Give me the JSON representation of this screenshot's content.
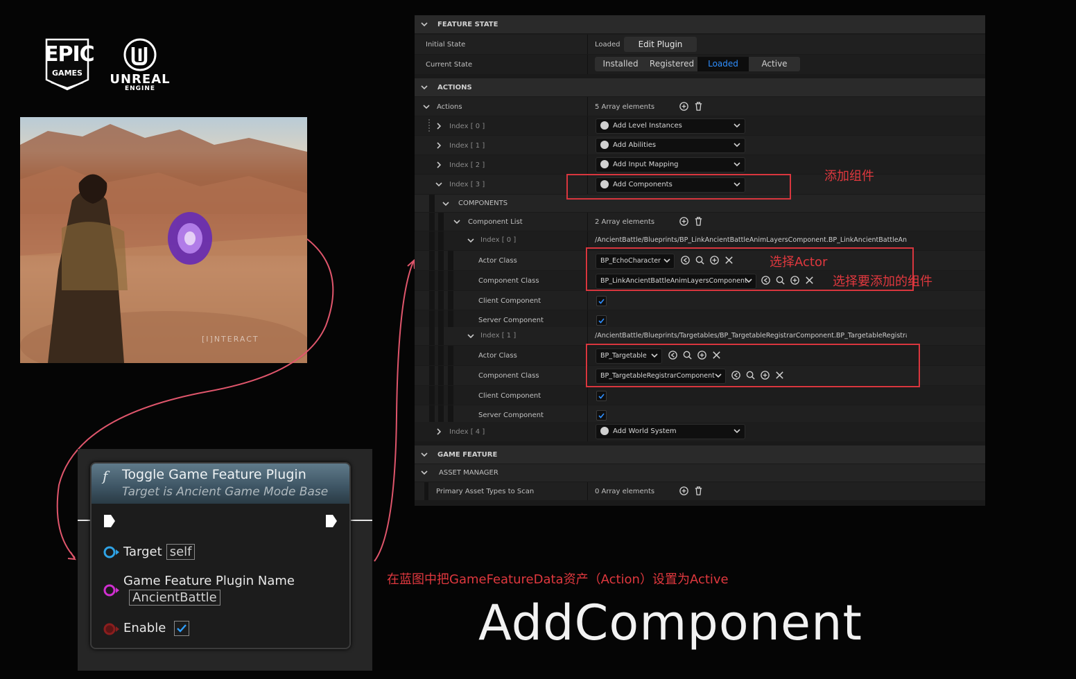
{
  "logos": {
    "epic_line1": "EPIC",
    "epic_line2": "GAMES",
    "unreal_line1": "UNREAL",
    "unreal_line2": "ENGINE"
  },
  "scene": {
    "watermark": "[I]NTERACT"
  },
  "node": {
    "title": "Toggle Game Feature Plugin",
    "subtitle": "Target is Ancient Game Mode Base",
    "target_label": "Target",
    "target_value": "self",
    "plugin_label": "Game Feature Plugin Name",
    "plugin_value": "AncientBattle",
    "enable_label": "Enable",
    "enable_checked": true
  },
  "panel": {
    "feature_state": {
      "header": "FEATURE STATE",
      "initial_state_label": "Initial State",
      "initial_state_value": "Loaded",
      "edit_plugin_button": "Edit Plugin",
      "current_state_label": "Current State",
      "states": [
        "Installed",
        "Registered",
        "Loaded",
        "Active"
      ],
      "selected_state": "Loaded"
    },
    "actions": {
      "header": "ACTIONS",
      "actions_label": "Actions",
      "actions_count": "5 Array elements",
      "items": [
        {
          "index": "Index [ 0 ]",
          "value": "Add Level Instances"
        },
        {
          "index": "Index [ 1 ]",
          "value": "Add Abilities"
        },
        {
          "index": "Index [ 2 ]",
          "value": "Add Input Mapping"
        },
        {
          "index": "Index [ 3 ]",
          "value": "Add Components"
        },
        {
          "index": "Index [ 4 ]",
          "value": "Add World System"
        }
      ],
      "components_header": "COMPONENTS",
      "component_list_label": "Component List",
      "component_list_count": "2 Array elements",
      "components": [
        {
          "index": "Index [ 0 ]",
          "path": "/AncientBattle/Blueprints/BP_LinkAncientBattleAnimLayersComponent.BP_LinkAncientBattleAnimLa",
          "actor_class_label": "Actor Class",
          "actor_class": "BP_EchoCharacter",
          "component_class_label": "Component Class",
          "component_class": "BP_LinkAncientBattleAnimLayersComponent",
          "client_label": "Client Component",
          "server_label": "Server Component",
          "client": true,
          "server": true
        },
        {
          "index": "Index [ 1 ]",
          "path": "/AncientBattle/Blueprints/Targetables/BP_TargetableRegistrarComponent.BP_TargetableRegistrarCc",
          "actor_class_label": "Actor Class",
          "actor_class": "BP_Targetable",
          "component_class_label": "Component Class",
          "component_class": "BP_TargetableRegistrarComponent",
          "client_label": "Client Component",
          "server_label": "Server Component",
          "client": true,
          "server": true
        }
      ]
    },
    "game_feature": {
      "header": "GAME FEATURE"
    },
    "asset_manager": {
      "header": "ASSET MANAGER",
      "primary_label": "Primary Asset Types to Scan",
      "primary_count": "0 Array elements"
    }
  },
  "annotations": {
    "add_components": "添加组件",
    "select_actor": "选择Actor",
    "select_component": "选择要添加的组件",
    "blueprint_note": "在蓝图中把GameFeatureData资产（Action）设置为Active"
  },
  "headline": "AddComponent",
  "colors": {
    "accent": "#2f8fff",
    "annotation": "#e0383e",
    "node_header": "#3d5463"
  }
}
